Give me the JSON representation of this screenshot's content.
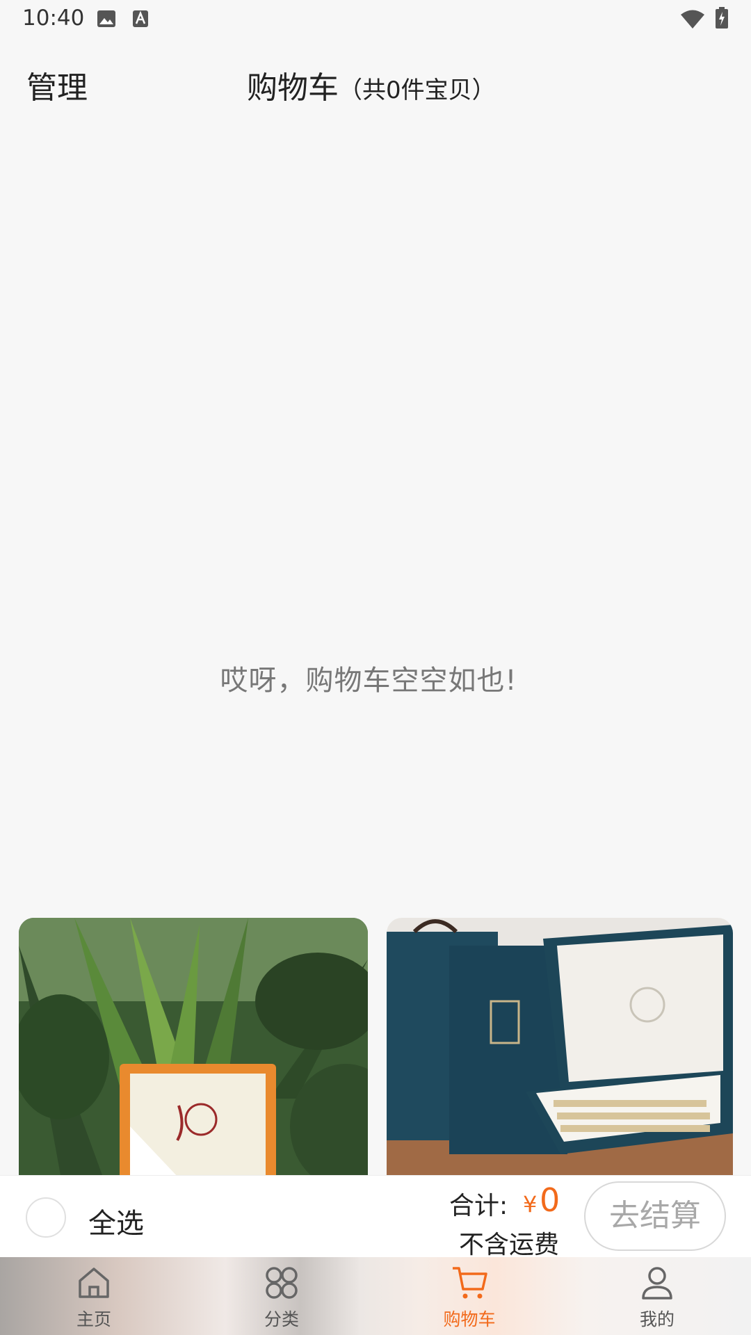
{
  "status_bar": {
    "time": "10:40"
  },
  "header": {
    "manage_label": "管理",
    "title": "购物车",
    "count_text": "（共0件宝贝）"
  },
  "empty_message": "哎呀，购物车空空如也!",
  "checkout": {
    "select_all_label": "全选",
    "total_label": "合计:",
    "currency": "¥",
    "total_value": "0",
    "shipping_note": "不含运费",
    "checkout_button": "去结算"
  },
  "tabs": [
    {
      "label": "主页",
      "icon": "home-icon"
    },
    {
      "label": "分类",
      "icon": "category-icon"
    },
    {
      "label": "购物车",
      "icon": "cart-icon",
      "active": true
    },
    {
      "label": "我的",
      "icon": "profile-icon"
    }
  ],
  "colors": {
    "accent": "#f26a1b",
    "background": "#f7f7f7"
  }
}
